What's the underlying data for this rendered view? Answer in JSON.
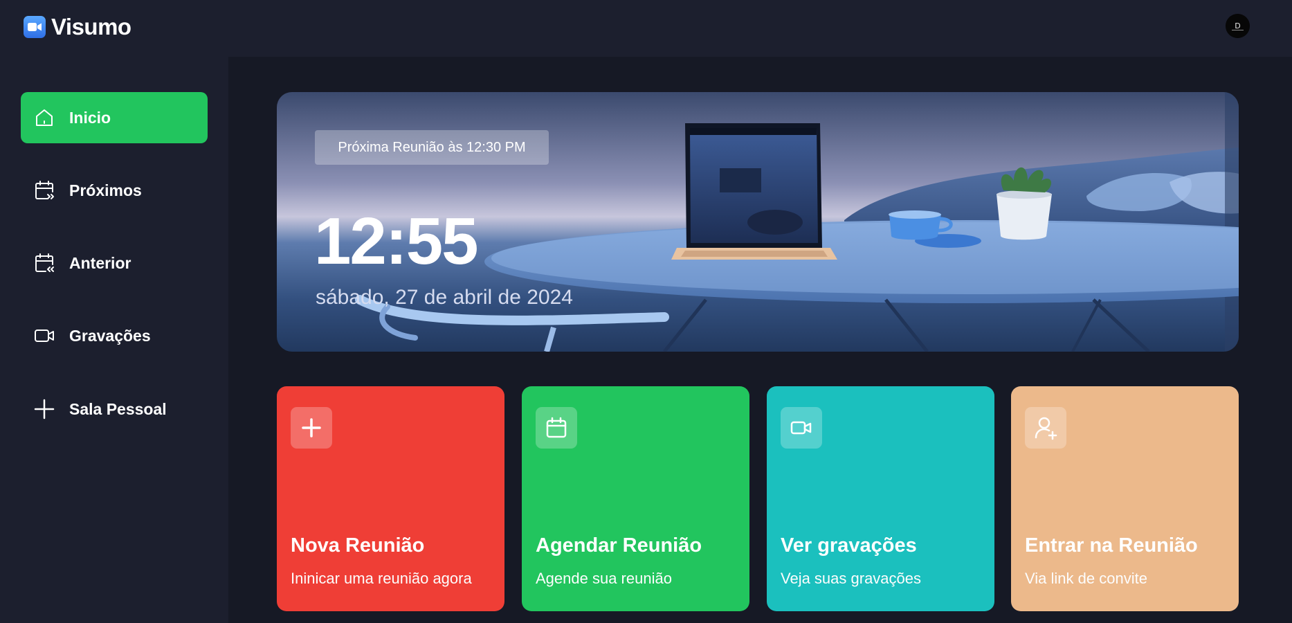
{
  "app": {
    "name": "Visumo",
    "logo_icon": "video-camera-icon",
    "avatar_text": "D"
  },
  "colors": {
    "background": "#161925",
    "panel": "#1c1f2e",
    "accent_green": "#22c55e",
    "card_red": "#ef3e36",
    "card_green": "#22c55e",
    "card_teal": "#1bc0be",
    "card_peach": "#ecb98b"
  },
  "sidebar": {
    "items": [
      {
        "label": "Inicio",
        "icon": "home-icon",
        "active": true
      },
      {
        "label": "Próximos",
        "icon": "calendar-next-icon",
        "active": false
      },
      {
        "label": "Anterior",
        "icon": "calendar-previous-icon",
        "active": false
      },
      {
        "label": "Gravações",
        "icon": "video-icon",
        "active": false
      },
      {
        "label": "Sala Pessoal",
        "icon": "plus-icon",
        "active": false
      }
    ]
  },
  "hero": {
    "next_meeting": "Próxima Reunião às 12:30 PM",
    "time": "12:55",
    "date": "sábado, 27 de abril de 2024"
  },
  "cards": [
    {
      "title": "Nova Reunião",
      "subtitle": "Ininicar uma reunião agora",
      "icon": "plus-icon"
    },
    {
      "title": "Agendar Reunião",
      "subtitle": "Agende sua reunião",
      "icon": "calendar-icon"
    },
    {
      "title": "Ver gravações",
      "subtitle": "Veja suas gravações",
      "icon": "video-icon"
    },
    {
      "title": "Entrar na Reunião",
      "subtitle": "Via link de convite",
      "icon": "user-plus-icon"
    }
  ]
}
